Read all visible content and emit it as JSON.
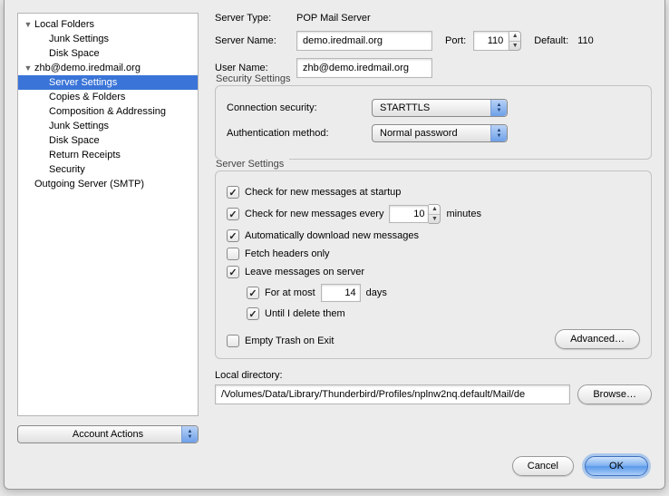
{
  "sidebar": {
    "accounts": [
      {
        "label": "Local Folders",
        "children": [
          {
            "label": "Junk Settings"
          },
          {
            "label": "Disk Space"
          }
        ]
      },
      {
        "label": "zhb@demo.iredmail.org",
        "children": [
          {
            "label": "Server Settings",
            "selected": true
          },
          {
            "label": "Copies & Folders"
          },
          {
            "label": "Composition & Addressing"
          },
          {
            "label": "Junk Settings"
          },
          {
            "label": "Disk Space"
          },
          {
            "label": "Return Receipts"
          },
          {
            "label": "Security"
          }
        ]
      },
      {
        "label": "Outgoing Server (SMTP)",
        "children": []
      }
    ],
    "account_actions": "Account Actions"
  },
  "header": {
    "server_type_label": "Server Type:",
    "server_type_value": "POP Mail Server",
    "server_name_label": "Server Name:",
    "server_name_value": "demo.iredmail.org",
    "port_label": "Port:",
    "port_value": "110",
    "default_label": "Default:",
    "default_value": "110",
    "user_name_label": "User Name:",
    "user_name_value": "zhb@demo.iredmail.org"
  },
  "security": {
    "title": "Security Settings",
    "conn_label": "Connection security:",
    "conn_value": "STARTTLS",
    "auth_label": "Authentication method:",
    "auth_value": "Normal password"
  },
  "server": {
    "title": "Server Settings",
    "check_startup": "Check for new messages at startup",
    "check_every_pre": "Check for new messages every",
    "check_every_value": "10",
    "check_every_post": "minutes",
    "auto_download": "Automatically download new messages",
    "fetch_headers": "Fetch headers only",
    "leave_on_server": "Leave messages on server",
    "for_at_most_pre": "For at most",
    "for_at_most_value": "14",
    "for_at_most_post": "days",
    "until_delete": "Until I delete them",
    "empty_trash": "Empty Trash on Exit",
    "advanced": "Advanced…"
  },
  "local_dir": {
    "label": "Local directory:",
    "value": "/Volumes/Data/Library/Thunderbird/Profiles/nplnw2nq.default/Mail/de",
    "browse": "Browse…"
  },
  "footer": {
    "cancel": "Cancel",
    "ok": "OK"
  }
}
